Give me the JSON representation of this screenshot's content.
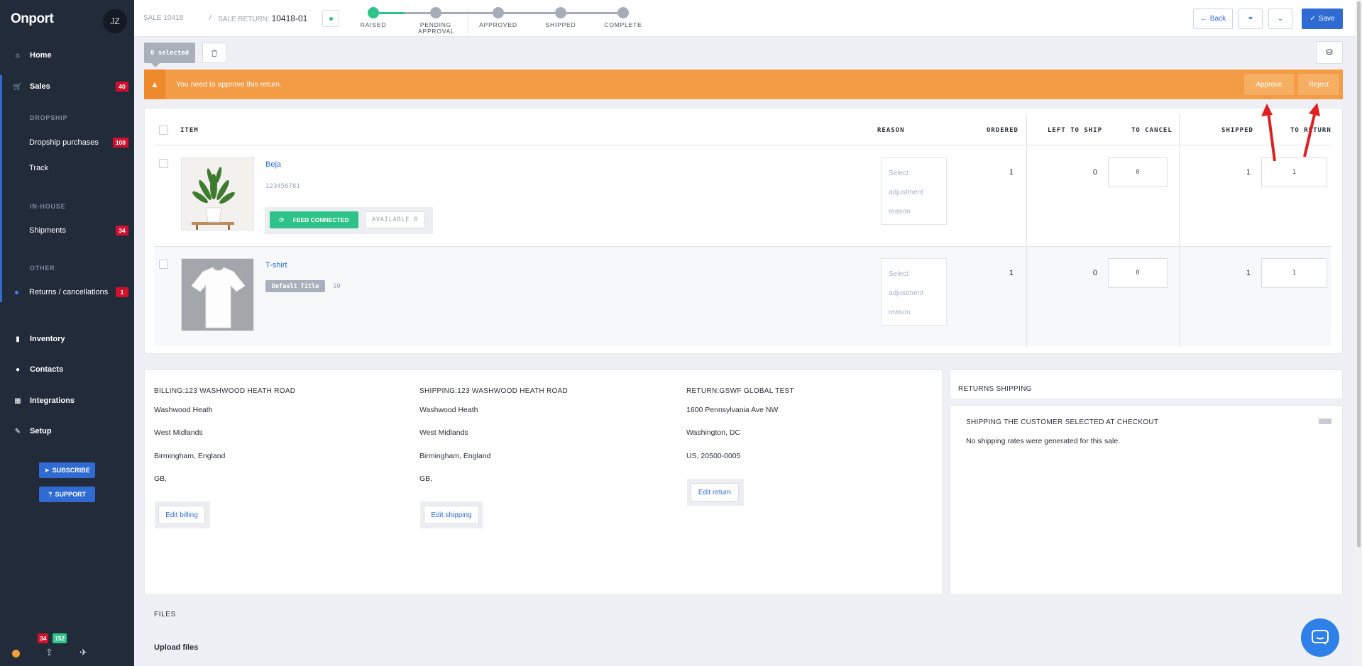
{
  "sidebar": {
    "logo": "Onport",
    "avatar": "JZ",
    "home": "Home",
    "sales": "Sales",
    "sales_badge": "40",
    "dropship_head": "DROPSHIP",
    "dropship_purchases": "Dropship purchases",
    "dropship_badge": "108",
    "track": "Track",
    "inhouse_head": "IN-HOUSE",
    "shipments": "Shipments",
    "shipments_badge": "34",
    "other_head": "OTHER",
    "returns": "Returns / cancellations",
    "returns_badge": "1",
    "inventory": "Inventory",
    "contacts": "Contacts",
    "integrations": "Integrations",
    "setup": "Setup",
    "subscribe": "SUBSCRIBE",
    "support": "SUPPORT",
    "foot_badge_red": "34",
    "foot_badge_green": "152"
  },
  "topbar": {
    "sale_label": "SALE 10418",
    "sep": "/",
    "return_label": "SALE RETURN:",
    "return_id": "10418-01",
    "steps": [
      "RAISED",
      "PENDING APPROVAL",
      "APPROVED",
      "SHIPPED",
      "COMPLETE"
    ],
    "back": "Back",
    "save": "Save"
  },
  "toolbar": {
    "selected": "0 selected"
  },
  "alert": {
    "text": "You need to approve this return.",
    "approve": "Approve",
    "reject": "Reject"
  },
  "table": {
    "headers": {
      "item": "ITEM",
      "reason": "REASON",
      "ordered": "ORDERED",
      "left_to_ship": "LEFT TO SHIP",
      "to_cancel": "TO CANCEL",
      "shipped": "SHIPPED",
      "to_return": "TO RETURN"
    },
    "rows": [
      {
        "name": "Beja",
        "sku": "123456781",
        "feed": "FEED CONNECTED",
        "available": "AVAILABLE 0",
        "reason": "Select adjustment reason",
        "ordered": "1",
        "left_to_ship": "0",
        "to_cancel": "0",
        "shipped": "1",
        "to_return": "1"
      },
      {
        "name": "T-shirt",
        "variant": "Default Title",
        "variant_sku": "10",
        "reason": "Select adjustment reason",
        "ordered": "1",
        "left_to_ship": "0",
        "to_cancel": "0",
        "shipped": "1",
        "to_return": "1"
      }
    ]
  },
  "addresses": {
    "billing": {
      "title": "BILLING:123 WASHWOOD HEATH ROAD",
      "lines": [
        "Washwood Heath",
        "West Midlands",
        "Birmingham, England",
        "GB,"
      ],
      "edit": "Edit billing"
    },
    "shipping": {
      "title": "SHIPPING:123 WASHWOOD HEATH ROAD",
      "lines": [
        "Washwood Heath",
        "West Midlands",
        "Birmingham, England",
        "GB,"
      ],
      "edit": "Edit shipping"
    },
    "return": {
      "title": "RETURN:GSWF GLOBAL TEST",
      "lines": [
        "1600 Pennsylvania Ave NW",
        "Washington, DC",
        "US, 20500-0005"
      ],
      "edit": "Edit return"
    }
  },
  "returns_shipping": {
    "title": "RETURNS SHIPPING",
    "sub_title": "SHIPPING THE CUSTOMER SELECTED AT CHECKOUT",
    "message": "No shipping rates were generated for this sale."
  },
  "files": {
    "title": "FILES",
    "upload": "Upload files"
  },
  "colors": {
    "sidebar": "#222b3a",
    "accent": "#2f6bd2",
    "alert": "#f39c45",
    "success": "#2ec489",
    "badge": "#d0102d"
  }
}
